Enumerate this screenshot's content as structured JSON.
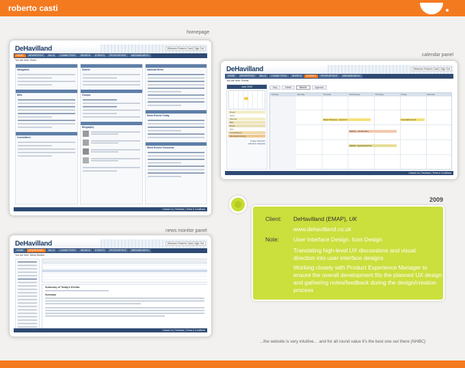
{
  "header": {
    "brand": "roberto casti"
  },
  "panels": {
    "homepage": {
      "label": "homepage",
      "logo": "DeHavilland",
      "user": "Welcome Roberto Casti | Sign Out",
      "nav": [
        "HOME",
        "NEWSFEEDS",
        "BILLS",
        "COMMITTEES",
        "SEARCH",
        "EVENTS",
        "PEOPLEPOINT",
        "MEDIASEARCH"
      ],
      "crumb": "You are here: Home",
      "col1_titles": [
        "Navigation",
        "Bills",
        "Committees"
      ],
      "col2_titles": [
        "Search",
        "Groups",
        "Biography"
      ],
      "col3_titles": [
        "National News",
        "News Events Today",
        "Week Events Tomorrow"
      ],
      "footer": "Contact Us | Feedback | Terms & Conditions"
    },
    "calendar": {
      "label": "calendar panel",
      "logo": "DeHavilland",
      "user": "Welcome Roberto Casti | Sign Out",
      "nav": [
        "HOME",
        "NEWSFEEDS",
        "BILLS",
        "COMMITTEES",
        "SEARCH",
        "EVENTS",
        "PEOPLEPOINT",
        "MEDIASEARCH"
      ],
      "crumb": "You are here: Events",
      "month": "June 2009",
      "tabs": [
        "Day",
        "Week",
        "Month",
        "Agenda"
      ],
      "days": [
        "Sunday",
        "Monday",
        "Tuesday",
        "Wednesday",
        "Thursday",
        "Friday",
        "Saturday"
      ],
      "events": [
        "Dawn Primarolo - Launch of",
        "Consultation Ends",
        "DEFRA - UK Mid Prize",
        "DEFRA - Agricultural Prize"
      ],
      "sidebar_items": [
        "Royal",
        "Open",
        "Internet",
        "Bills",
        "Rural",
        "Nhs",
        "Consultations",
        "Ministerial Activity"
      ],
      "actions": [
        "Create Selection",
        "Add New Calendar"
      ],
      "footer": "Contact Us | Feedback | Terms & Conditions"
    },
    "news_monitor": {
      "label": "news monitor panel",
      "logo": "DeHavilland",
      "user": "Welcome Roberto Casti | Sign Out",
      "nav": [
        "HOME",
        "NEWSFEEDS",
        "BILLS",
        "COMMITTEES",
        "SEARCH",
        "EVENTS",
        "PEOPLEPOINT",
        "MEDIASEARCH"
      ],
      "crumb": "You are here: News Monitor",
      "preview_title": "Summary of Today's Events",
      "preview_section": "Summary",
      "footer": "Contact Us | Feedback | Terms & Conditions"
    }
  },
  "year": "2009",
  "info": {
    "client_label": "Client:",
    "client_name": "DeHavilland (EMAP), ",
    "client_suffix": "UK",
    "url": "www.dehavilland.co.uk",
    "note_label": "Note:",
    "note_1": "User Interface Design. Icon Design",
    "note_2": "Translating high-level UX discussions and visual direction into user interface designs",
    "note_3": "Working closely with Product Experience Manager to ensure the overall development fits the planned UX design and gathering notes/feedback during the design/creation process"
  },
  "quote": {
    "text": "...the website is very intuitive… and for all round value it's the best one out there ",
    "source": "(NHBC)"
  },
  "colors": {
    "accent": "#f47a20",
    "lime": "#cbdf3d",
    "navy": "#2e4a73"
  }
}
